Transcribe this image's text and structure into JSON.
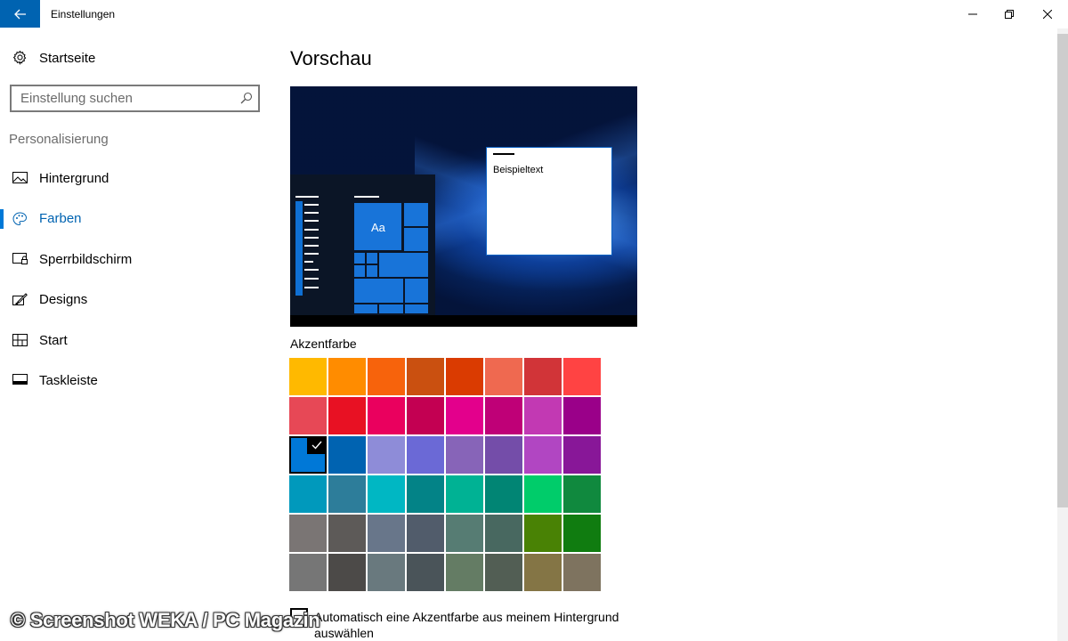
{
  "window": {
    "title": "Einstellungen",
    "back_icon": "arrow-left-icon",
    "minimize_icon": "minimize-icon",
    "maximize_icon": "restore-icon",
    "close_icon": "close-icon",
    "accent": "#0063b1"
  },
  "sidebar": {
    "home": {
      "label": "Startseite",
      "icon": "gear-icon"
    },
    "search": {
      "placeholder": "Einstellung suchen",
      "icon": "search-icon"
    },
    "group": "Personalisierung",
    "items": [
      {
        "label": "Hintergrund",
        "icon": "image-icon",
        "active": false
      },
      {
        "label": "Farben",
        "icon": "palette-icon",
        "active": true
      },
      {
        "label": "Sperrbildschirm",
        "icon": "lockscreen-icon",
        "active": false
      },
      {
        "label": "Designs",
        "icon": "brush-icon",
        "active": false
      },
      {
        "label": "Start",
        "icon": "start-tiles-icon",
        "active": false
      },
      {
        "label": "Taskleiste",
        "icon": "taskbar-icon",
        "active": false
      }
    ]
  },
  "main": {
    "heading": "Vorschau",
    "preview": {
      "sample_text": "Beispieltext",
      "tile_label": "Aa"
    },
    "accent_label": "Akzentfarbe",
    "selected_color": "#0078d7",
    "swatch_rows": [
      [
        "#ffb900",
        "#ff8c00",
        "#f7630c",
        "#ca5010",
        "#da3b01",
        "#ef6950",
        "#d13438",
        "#ff4343"
      ],
      [
        "#e74856",
        "#e81123",
        "#ea005e",
        "#c30052",
        "#e3008c",
        "#bf0077",
        "#c239b3",
        "#9a0089"
      ],
      [
        "#0078d7",
        "#0063b1",
        "#8e8cd8",
        "#6b69d6",
        "#8764b8",
        "#744da9",
        "#b146c2",
        "#881798"
      ],
      [
        "#0099bc",
        "#2d7d9a",
        "#00b7c3",
        "#038387",
        "#00b294",
        "#018574",
        "#00cc6a",
        "#10893e"
      ],
      [
        "#7a7574",
        "#5d5a58",
        "#68768a",
        "#515c6b",
        "#567c73",
        "#486860",
        "#498205",
        "#107c10"
      ],
      [
        "#767676",
        "#4c4a48",
        "#69797e",
        "#4a5459",
        "#647c64",
        "#525e54",
        "#847545",
        "#7e735f"
      ]
    ],
    "auto_accent": {
      "checked": false,
      "label": "Automatisch eine Akzentfarbe aus meinem Hintergrund auswählen"
    }
  },
  "watermark": "© Screenshot WEKA / PC Magazin"
}
